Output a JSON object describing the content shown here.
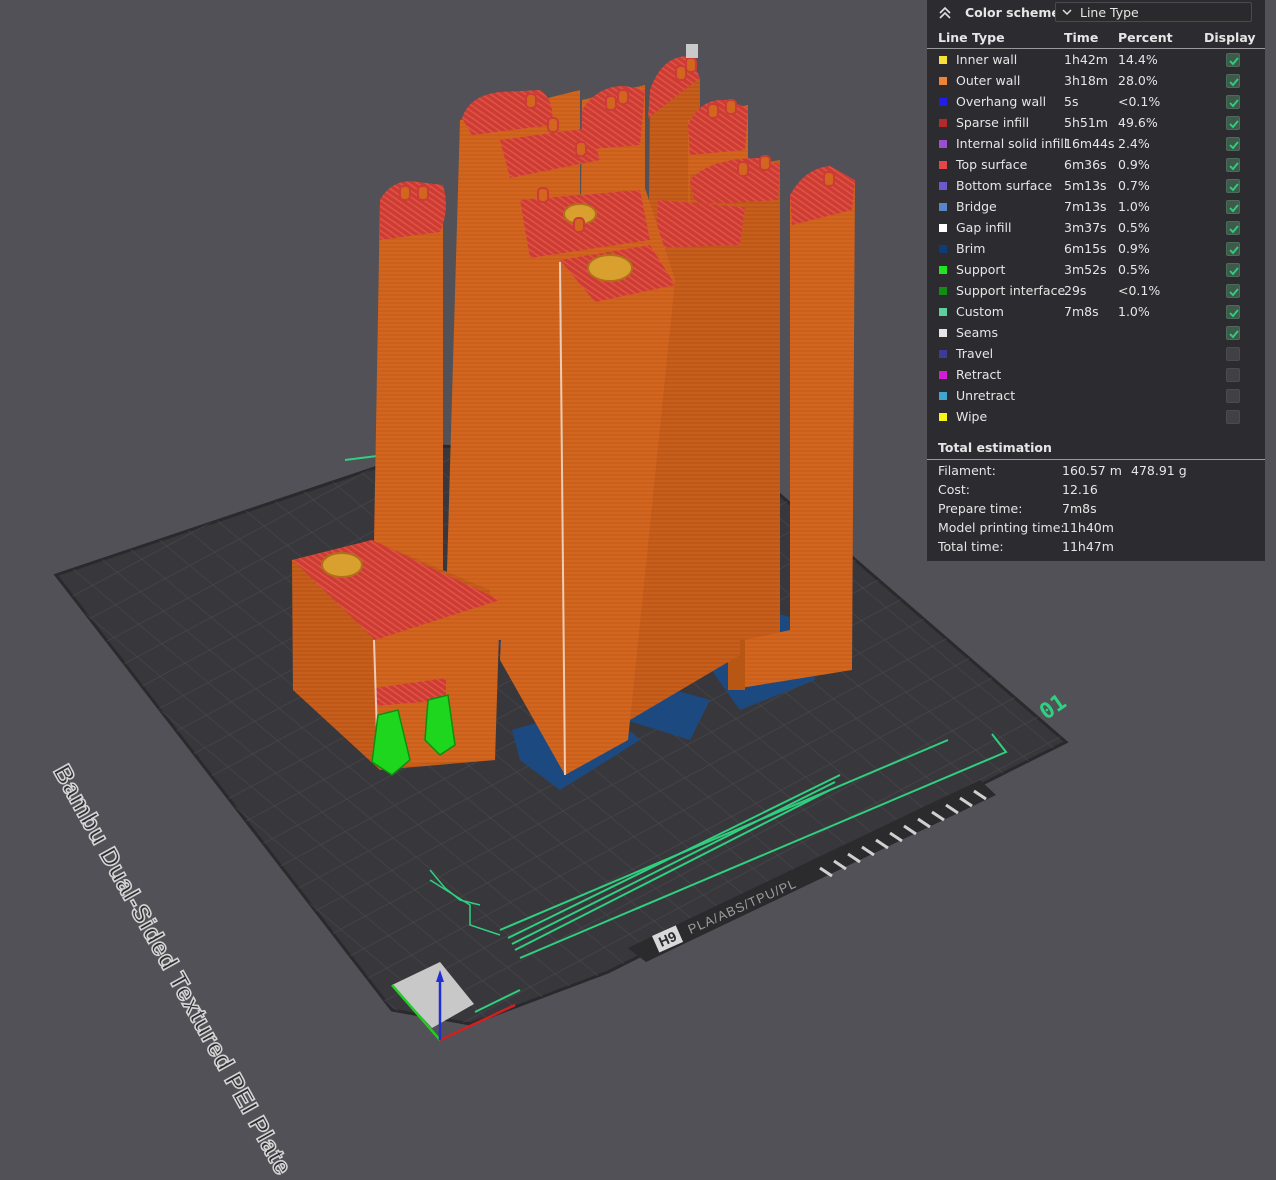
{
  "plate": {
    "label": "Bambu Dual-Sided Textured PEI Plate",
    "number": "01",
    "brand_logo": "H9",
    "materials": "PLA/ABS/TPU/PL"
  },
  "colors": {
    "background": "#515157",
    "plate": "#38383c",
    "grid": "#47474c",
    "wall": "#d0641e",
    "top_surface": "#cc3b36",
    "brim": "#1e4e86",
    "support": "#1ed61e",
    "accent_green": "#2fd07f"
  },
  "panel": {
    "color_scheme_label": "Color scheme",
    "color_scheme_value": "Line Type",
    "headers": {
      "line_type": "Line Type",
      "time": "Time",
      "percent": "Percent",
      "display": "Display"
    },
    "line_types": [
      {
        "name": "Inner wall",
        "time": "1h42m",
        "percent": "14.4%",
        "color": "#f5e13a",
        "display": true
      },
      {
        "name": "Outer wall",
        "time": "3h18m",
        "percent": "28.0%",
        "color": "#f08234",
        "display": true
      },
      {
        "name": "Overhang wall",
        "time": "5s",
        "percent": "<0.1%",
        "color": "#1f1fe6",
        "display": true
      },
      {
        "name": "Sparse infill",
        "time": "5h51m",
        "percent": "49.6%",
        "color": "#b22a2a",
        "display": true
      },
      {
        "name": "Internal solid infill",
        "time": "16m44s",
        "percent": "2.4%",
        "color": "#9b4fcf",
        "display": true
      },
      {
        "name": "Top surface",
        "time": "6m36s",
        "percent": "0.9%",
        "color": "#e64646",
        "display": true
      },
      {
        "name": "Bottom surface",
        "time": "5m13s",
        "percent": "0.7%",
        "color": "#6a5acd",
        "display": true
      },
      {
        "name": "Bridge",
        "time": "7m13s",
        "percent": "1.0%",
        "color": "#5a86c8",
        "display": true
      },
      {
        "name": "Gap infill",
        "time": "3m37s",
        "percent": "0.5%",
        "color": "#ffffff",
        "display": true
      },
      {
        "name": "Brim",
        "time": "6m15s",
        "percent": "0.9%",
        "color": "#0f3c78",
        "display": true
      },
      {
        "name": "Support",
        "time": "3m52s",
        "percent": "0.5%",
        "color": "#1fe41f",
        "display": true
      },
      {
        "name": "Support interface",
        "time": "29s",
        "percent": "<0.1%",
        "color": "#128c12",
        "display": true
      },
      {
        "name": "Custom",
        "time": "7m8s",
        "percent": "1.0%",
        "color": "#5ecf9a",
        "display": true
      },
      {
        "name": "Seams",
        "time": "",
        "percent": "",
        "color": "#e6e6e6",
        "display": true
      },
      {
        "name": "Travel",
        "time": "",
        "percent": "",
        "color": "#3b3b9a",
        "display": false
      },
      {
        "name": "Retract",
        "time": "",
        "percent": "",
        "color": "#d21ed2",
        "display": false
      },
      {
        "name": "Unretract",
        "time": "",
        "percent": "",
        "color": "#3fa6d0",
        "display": false
      },
      {
        "name": "Wipe",
        "time": "",
        "percent": "",
        "color": "#f5f518",
        "display": false
      }
    ],
    "total_estimation": {
      "title": "Total estimation",
      "rows": [
        {
          "label": "Filament:",
          "value": "160.57 m",
          "value2": "478.91 g"
        },
        {
          "label": "Cost:",
          "value": "12.16",
          "value2": ""
        },
        {
          "label": "Prepare time:",
          "value": "7m8s",
          "value2": ""
        },
        {
          "label": "Model printing time:",
          "value": "11h40m",
          "value2": ""
        },
        {
          "label": "Total time:",
          "value": "11h47m",
          "value2": ""
        }
      ]
    }
  }
}
